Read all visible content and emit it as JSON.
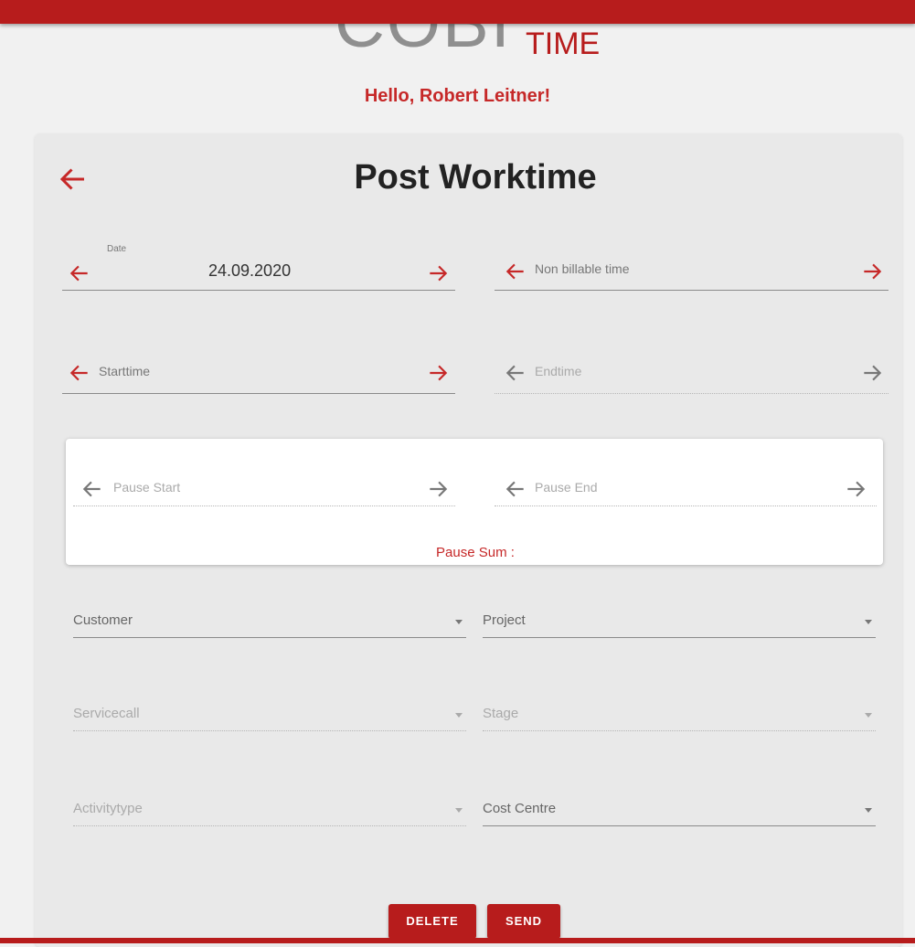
{
  "app": {
    "logo_main": "COBI",
    "logo_sub": "TIME",
    "greeting": "Hello, Robert Leitner!"
  },
  "page": {
    "title": "Post Worktime"
  },
  "colors": {
    "accent": "#c62828",
    "bar": "#b71c1c",
    "card": "#e9e9e9"
  },
  "icons": {
    "back": "arrow-left-icon",
    "prev": "arrow-left-icon",
    "next": "arrow-right-icon",
    "dropdown": "caret-down-icon"
  },
  "form": {
    "date": {
      "label": "Date",
      "value": "24.09.2020"
    },
    "non_billable": {
      "placeholder": "Non billable time"
    },
    "starttime": {
      "placeholder": "Starttime"
    },
    "endtime": {
      "placeholder": "Endtime"
    },
    "pause_start": {
      "placeholder": "Pause Start"
    },
    "pause_end": {
      "placeholder": "Pause End"
    },
    "pause_sum": {
      "label": "Pause Sum :"
    },
    "customer": {
      "label": "Customer"
    },
    "project": {
      "label": "Project"
    },
    "servicecall": {
      "label": "Servicecall"
    },
    "stage": {
      "label": "Stage"
    },
    "activitytype": {
      "label": "Activitytype"
    },
    "cost_centre": {
      "label": "Cost Centre"
    }
  },
  "actions": {
    "delete": "DELETE",
    "send": "SEND"
  }
}
